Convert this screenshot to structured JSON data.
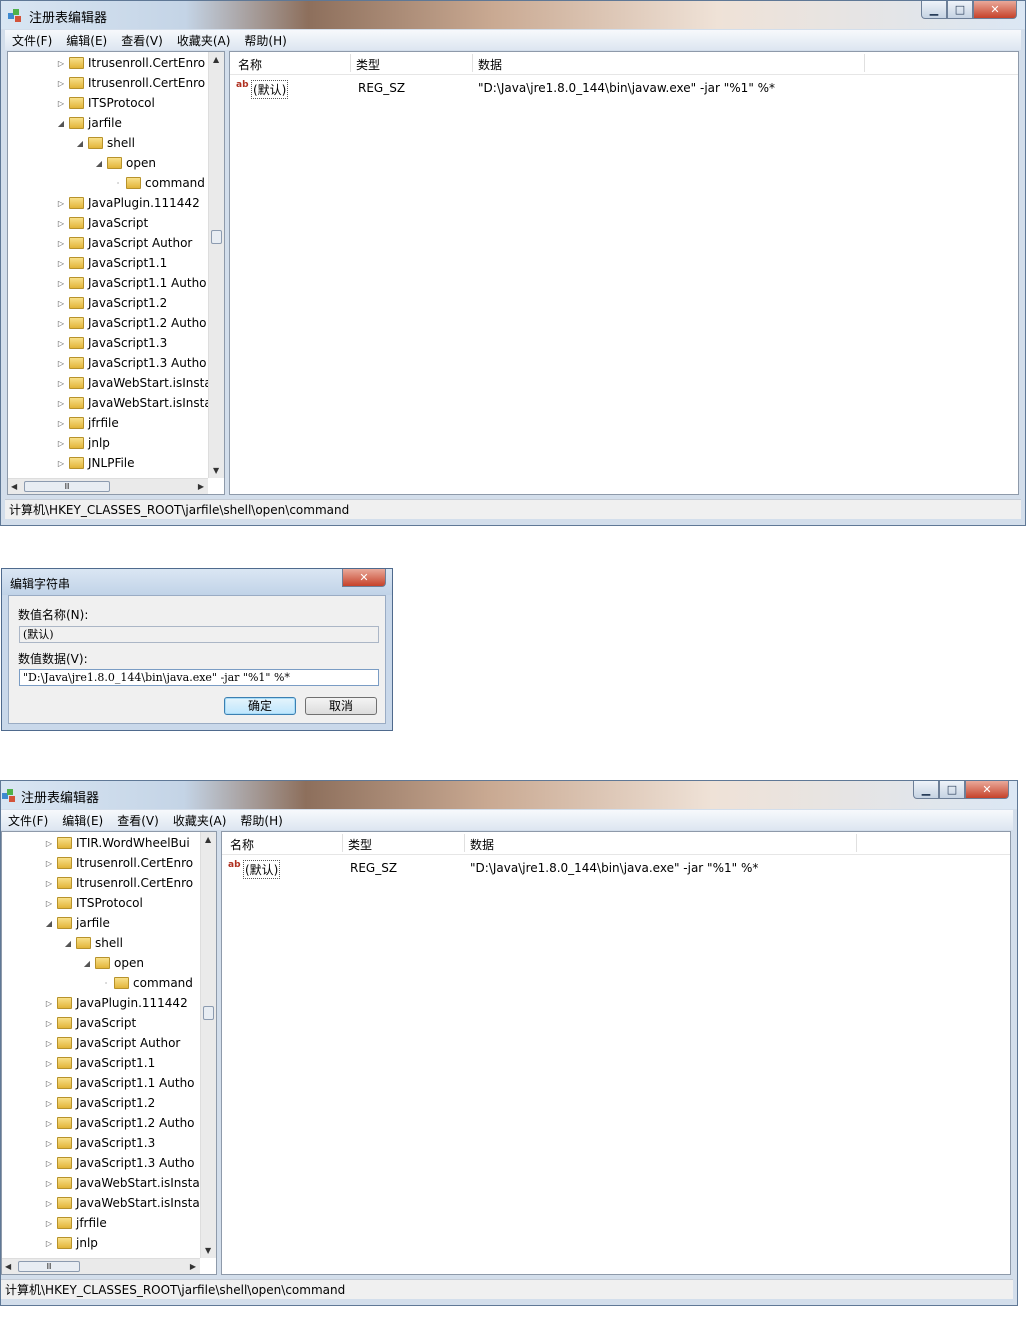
{
  "window1": {
    "title": "注册表编辑器",
    "menu": [
      "文件(F)",
      "编辑(E)",
      "查看(V)",
      "收藏夹(A)",
      "帮助(H)"
    ],
    "tree": [
      {
        "label": "Itrusenroll.CertEnro",
        "level": 0,
        "arrow": "right"
      },
      {
        "label": "Itrusenroll.CertEnro",
        "level": 0,
        "arrow": "right"
      },
      {
        "label": "ITSProtocol",
        "level": 0,
        "arrow": "right"
      },
      {
        "label": "jarfile",
        "level": 0,
        "arrow": "down"
      },
      {
        "label": "shell",
        "level": 1,
        "arrow": "down"
      },
      {
        "label": "open",
        "level": 2,
        "arrow": "down"
      },
      {
        "label": "command",
        "level": 3,
        "arrow": "none"
      },
      {
        "label": "JavaPlugin.111442",
        "level": 0,
        "arrow": "right"
      },
      {
        "label": "JavaScript",
        "level": 0,
        "arrow": "right"
      },
      {
        "label": "JavaScript Author",
        "level": 0,
        "arrow": "right"
      },
      {
        "label": "JavaScript1.1",
        "level": 0,
        "arrow": "right"
      },
      {
        "label": "JavaScript1.1 Autho",
        "level": 0,
        "arrow": "right"
      },
      {
        "label": "JavaScript1.2",
        "level": 0,
        "arrow": "right"
      },
      {
        "label": "JavaScript1.2 Autho",
        "level": 0,
        "arrow": "right"
      },
      {
        "label": "JavaScript1.3",
        "level": 0,
        "arrow": "right"
      },
      {
        "label": "JavaScript1.3 Autho",
        "level": 0,
        "arrow": "right"
      },
      {
        "label": "JavaWebStart.isInsta",
        "level": 0,
        "arrow": "right"
      },
      {
        "label": "JavaWebStart.isInsta",
        "level": 0,
        "arrow": "right"
      },
      {
        "label": "jfrfile",
        "level": 0,
        "arrow": "right"
      },
      {
        "label": "jnlp",
        "level": 0,
        "arrow": "right"
      },
      {
        "label": "JNLPFile",
        "level": 0,
        "arrow": "right"
      }
    ],
    "columns": {
      "name": "名称",
      "type": "类型",
      "data": "数据"
    },
    "row": {
      "name": "(默认)",
      "type": "REG_SZ",
      "data": "\"D:\\Java\\jre1.8.0_144\\bin\\javaw.exe\" -jar \"%1\" %*"
    },
    "status": "计算机\\HKEY_CLASSES_ROOT\\jarfile\\shell\\open\\command"
  },
  "dialog": {
    "title": "编辑字符串",
    "name_label": "数值名称(N):",
    "name_value": "(默认)",
    "data_label": "数值数据(V):",
    "data_value": "\"D:\\Java\\jre1.8.0_144\\bin\\java.exe\" -jar \"%1\" %*",
    "ok": "确定",
    "cancel": "取消"
  },
  "window2": {
    "title": "注册表编辑器",
    "menu": [
      "文件(F)",
      "编辑(E)",
      "查看(V)",
      "收藏夹(A)",
      "帮助(H)"
    ],
    "tree": [
      {
        "label": "ITIR.WordWheelBui",
        "level": 0,
        "arrow": "right"
      },
      {
        "label": "Itrusenroll.CertEnro",
        "level": 0,
        "arrow": "right"
      },
      {
        "label": "Itrusenroll.CertEnro",
        "level": 0,
        "arrow": "right"
      },
      {
        "label": "ITSProtocol",
        "level": 0,
        "arrow": "right"
      },
      {
        "label": "jarfile",
        "level": 0,
        "arrow": "down"
      },
      {
        "label": "shell",
        "level": 1,
        "arrow": "down"
      },
      {
        "label": "open",
        "level": 2,
        "arrow": "down"
      },
      {
        "label": "command",
        "level": 3,
        "arrow": "none"
      },
      {
        "label": "JavaPlugin.111442",
        "level": 0,
        "arrow": "right"
      },
      {
        "label": "JavaScript",
        "level": 0,
        "arrow": "right"
      },
      {
        "label": "JavaScript Author",
        "level": 0,
        "arrow": "right"
      },
      {
        "label": "JavaScript1.1",
        "level": 0,
        "arrow": "right"
      },
      {
        "label": "JavaScript1.1 Autho",
        "level": 0,
        "arrow": "right"
      },
      {
        "label": "JavaScript1.2",
        "level": 0,
        "arrow": "right"
      },
      {
        "label": "JavaScript1.2 Autho",
        "level": 0,
        "arrow": "right"
      },
      {
        "label": "JavaScript1.3",
        "level": 0,
        "arrow": "right"
      },
      {
        "label": "JavaScript1.3 Autho",
        "level": 0,
        "arrow": "right"
      },
      {
        "label": "JavaWebStart.isInsta",
        "level": 0,
        "arrow": "right"
      },
      {
        "label": "JavaWebStart.isInsta",
        "level": 0,
        "arrow": "right"
      },
      {
        "label": "jfrfile",
        "level": 0,
        "arrow": "right"
      },
      {
        "label": "jnlp",
        "level": 0,
        "arrow": "right"
      }
    ],
    "columns": {
      "name": "名称",
      "type": "类型",
      "data": "数据"
    },
    "row": {
      "name": "(默认)",
      "type": "REG_SZ",
      "data": "\"D:\\Java\\jre1.8.0_144\\bin\\java.exe\" -jar \"%1\" %*"
    },
    "status": "计算机\\HKEY_CLASSES_ROOT\\jarfile\\shell\\open\\command"
  }
}
